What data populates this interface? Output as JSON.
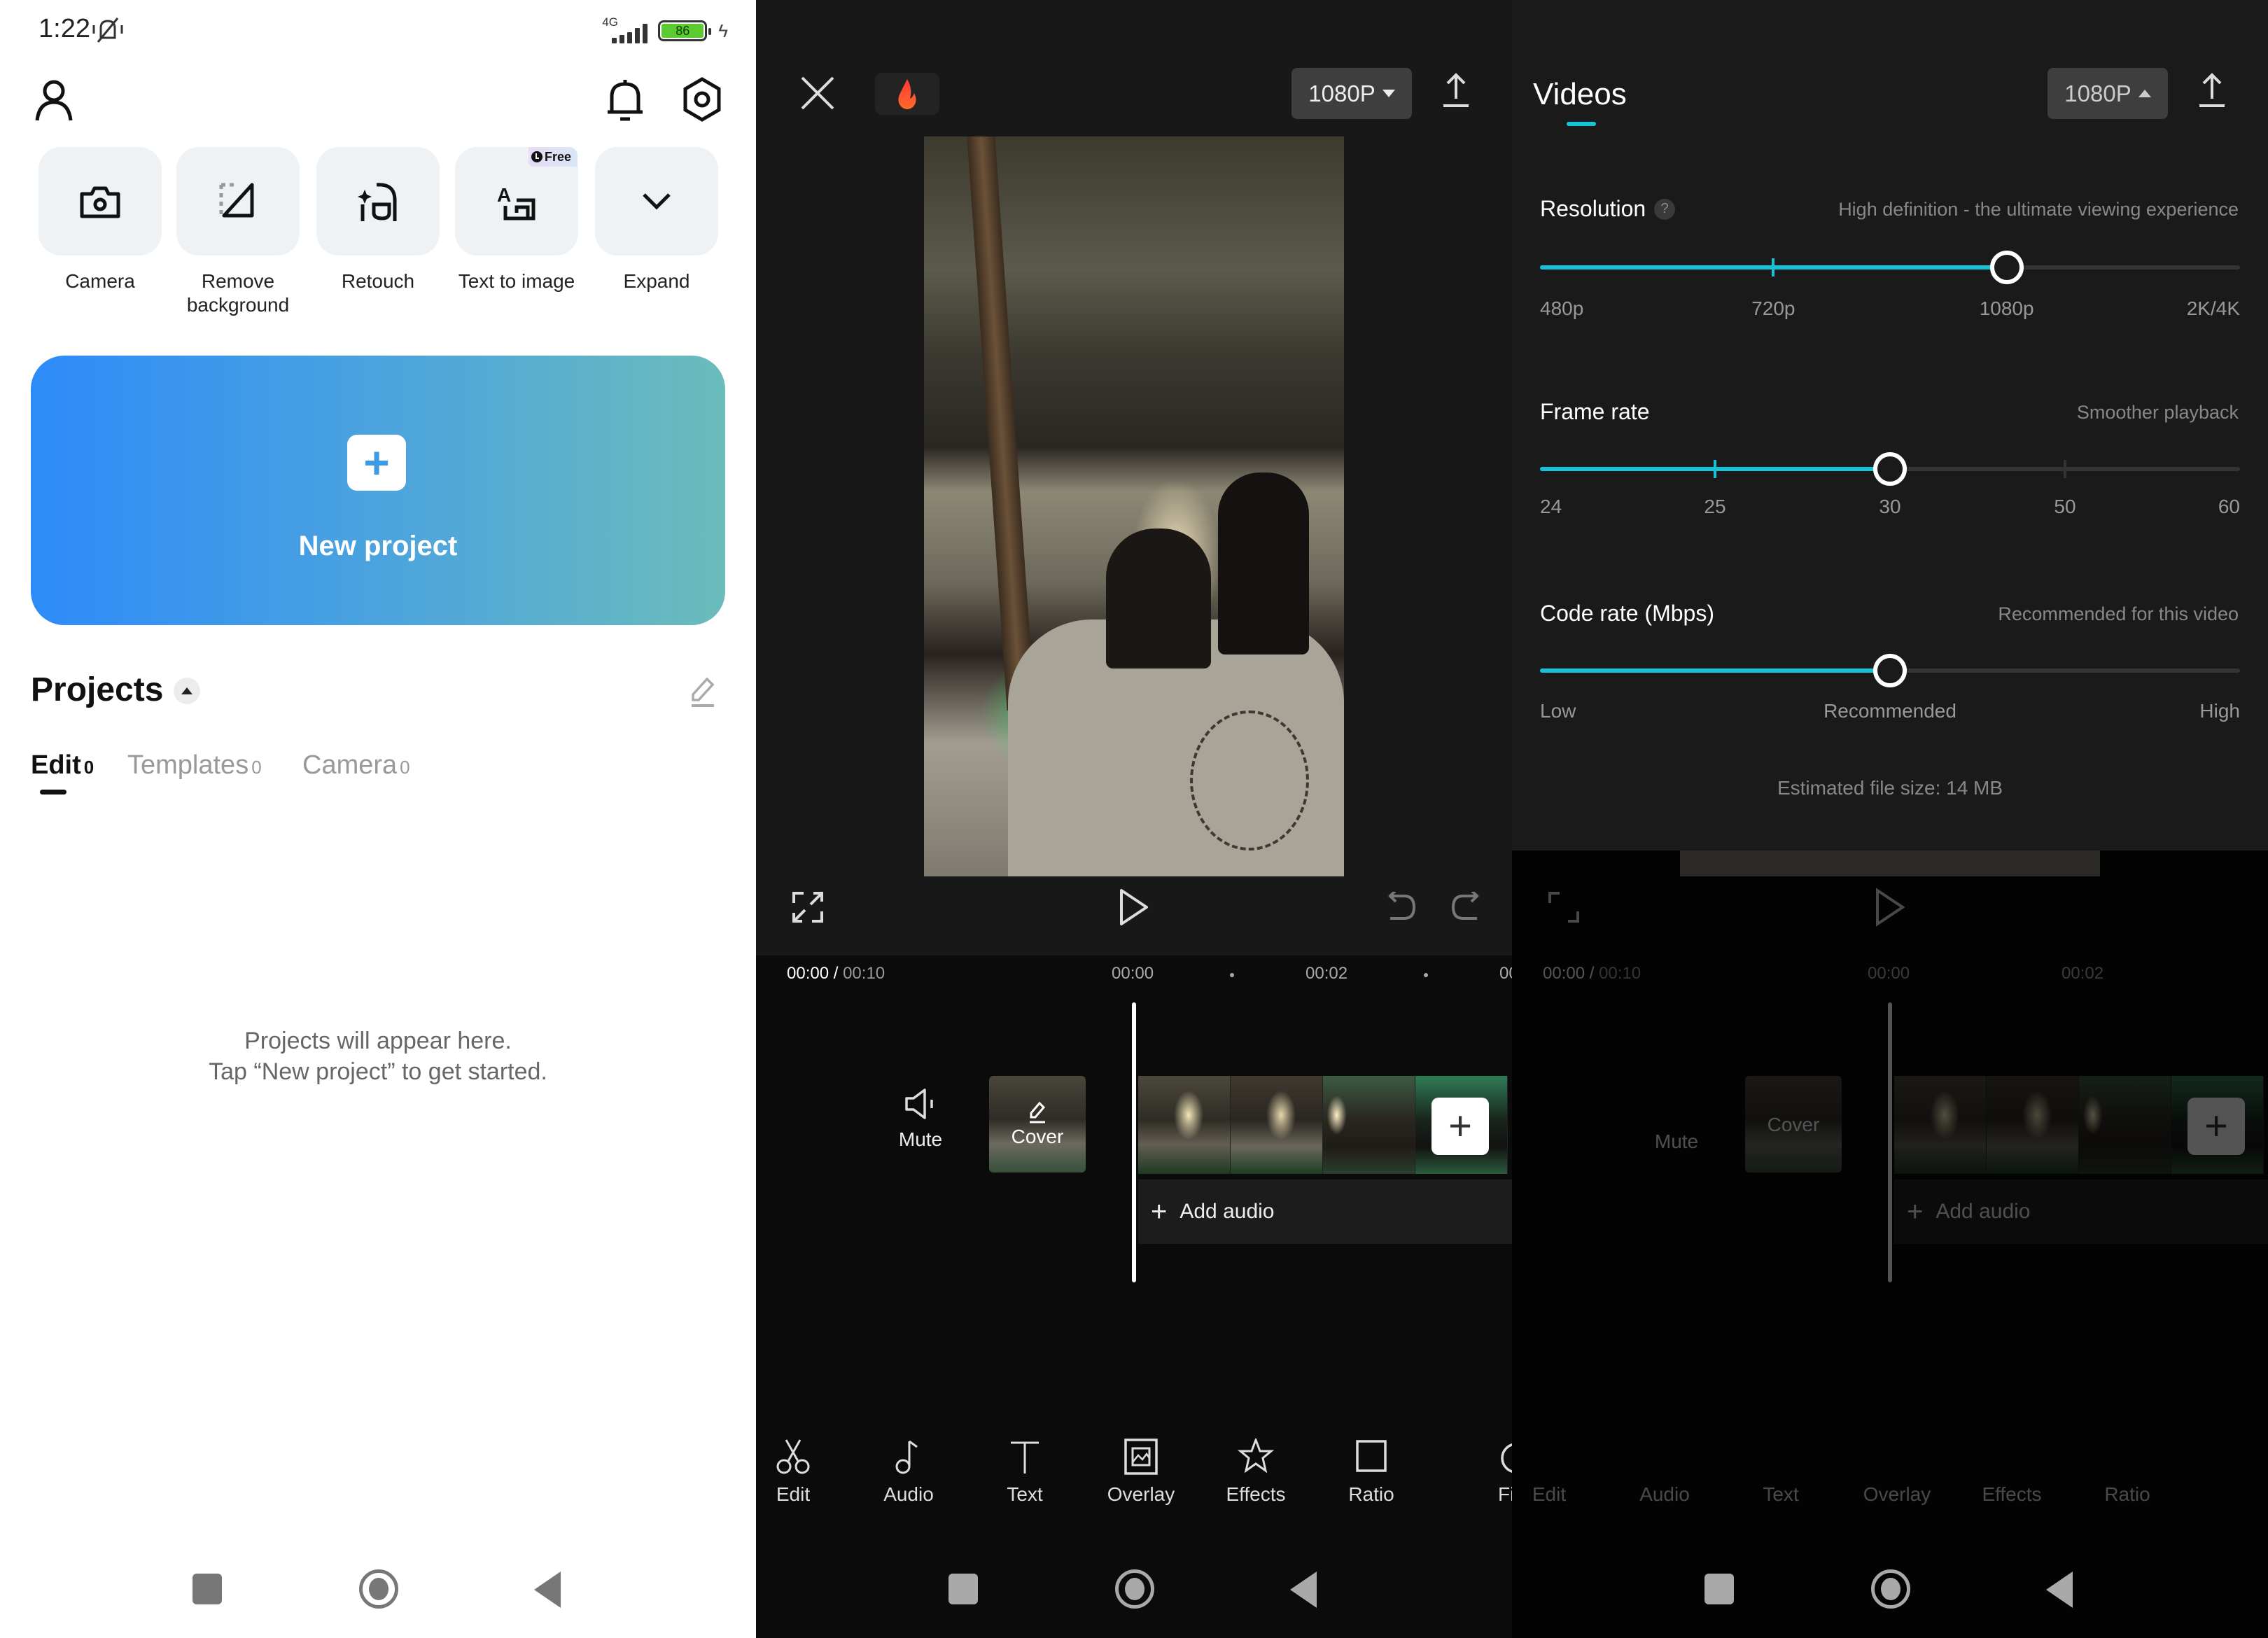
{
  "status_bar": {
    "time": "1:22",
    "network": "4G",
    "battery_level": "86",
    "battery_color": "#5ccb32"
  },
  "home": {
    "header_icons": [
      "profile-icon",
      "notification-bell-icon",
      "settings-icon"
    ],
    "tools": [
      {
        "label": "Camera",
        "icon": "camera-icon"
      },
      {
        "label": "Remove background",
        "icon": "remove-background-icon"
      },
      {
        "label": "Retouch",
        "icon": "retouch-icon"
      },
      {
        "label": "Text to image",
        "icon": "text-to-image-icon",
        "badge": "Free"
      },
      {
        "label": "Expand",
        "icon": "chevron-down-icon"
      }
    ],
    "new_project_label": "New project",
    "new_project_gradient": [
      "#2d8bf9",
      "#6bbcbb"
    ],
    "projects_title": "Projects",
    "tabs": [
      {
        "label": "Edit",
        "count": "0",
        "active": true
      },
      {
        "label": "Templates",
        "count": "0",
        "active": false
      },
      {
        "label": "Camera",
        "count": "0",
        "active": false
      }
    ],
    "empty_line1": "Projects will appear here.",
    "empty_line2": "Tap “New project” to get started."
  },
  "editor": {
    "resolution_button": "1080P",
    "current_time": "00:00",
    "total_time": "00:10",
    "ruler_labels": [
      "00:00",
      "00:02",
      "00"
    ],
    "mute_label": "Mute",
    "cover_label": "Cover",
    "add_audio_label": "Add audio",
    "toolbar": [
      {
        "label": "Edit",
        "icon": "scissors-icon"
      },
      {
        "label": "Audio",
        "icon": "music-note-icon"
      },
      {
        "label": "Text",
        "icon": "text-icon"
      },
      {
        "label": "Overlay",
        "icon": "overlay-icon"
      },
      {
        "label": "Effects",
        "icon": "effects-star-icon"
      },
      {
        "label": "Ratio",
        "icon": "ratio-icon"
      },
      {
        "label": "Fi",
        "icon": "filters-icon"
      }
    ]
  },
  "export": {
    "tab_label": "Videos",
    "resolution_button": "1080P",
    "accent_color": "#17c2d7",
    "resolution": {
      "title": "Resolution",
      "hint": "High definition - the ultimate viewing experience",
      "options": [
        "480p",
        "720p",
        "1080p",
        "2K/4K"
      ],
      "selected": "1080p"
    },
    "frame_rate": {
      "title": "Frame rate",
      "hint": "Smoother playback",
      "options": [
        "24",
        "25",
        "30",
        "50",
        "60"
      ],
      "selected": "30"
    },
    "code_rate": {
      "title": "Code rate (Mbps)",
      "hint": "Recommended for this video",
      "options": [
        "Low",
        "Recommended",
        "High"
      ],
      "selected": "Recommended"
    },
    "estimated_size": "Estimated file size: 14 MB"
  }
}
